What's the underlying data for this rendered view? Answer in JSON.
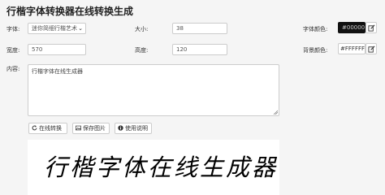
{
  "page": {
    "title": "行楷字体转换器在线转换生成"
  },
  "form": {
    "font_label": "字体:",
    "font_value": "迷你简细行楷艺术",
    "size_label": "大小:",
    "size_value": "38",
    "font_color_label": "字体颜色:",
    "font_color_value": "#000000",
    "width_label": "宽度:",
    "width_value": "570",
    "height_label": "高度:",
    "height_value": "120",
    "bg_color_label": "背景颜色:",
    "bg_color_value": "#FFFFFF",
    "content_label": "内容:",
    "content_value": "行楷字体在线生成器"
  },
  "buttons": {
    "convert": "在线转换",
    "save": "保存图片",
    "help": "使用说明"
  },
  "preview": {
    "text": "行楷字体在线生成器"
  },
  "colors": {
    "font": "#000000",
    "background": "#FFFFFF"
  },
  "icons": {
    "dropdown": "chevron-down-icon",
    "picker": "edit-icon",
    "convert": "refresh-icon",
    "save": "image-icon",
    "help": "info-icon"
  }
}
